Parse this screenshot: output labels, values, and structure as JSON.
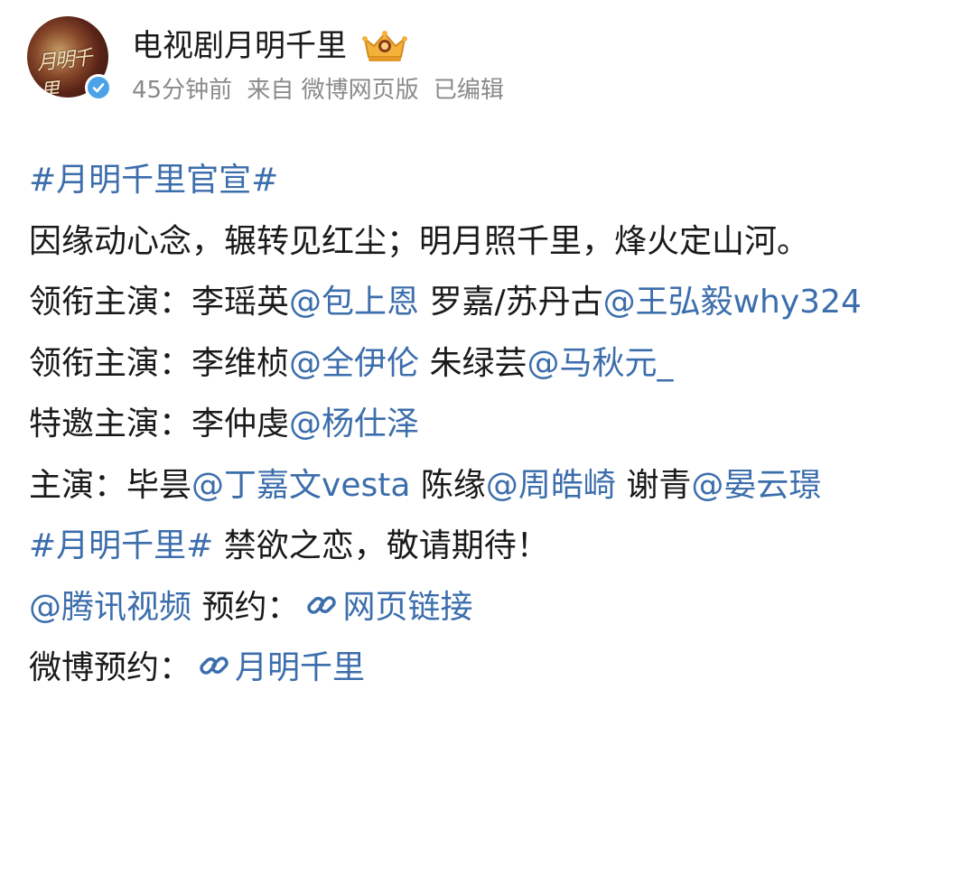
{
  "post": {
    "user_name": "电视剧月明千里",
    "avatar_text": "月明千里",
    "time": "45分钟前",
    "source": "来自 微博网页版",
    "edited": "已编辑"
  },
  "content": {
    "line1_topic": "#月明千里官宣#",
    "line2": "因缘动心念，辗转见红尘；明月照千里，烽火定山河。",
    "line3_label": "领衔主演：李瑶英",
    "line3_mention1": "@包上恩",
    "line3_text2": " 罗嘉/苏丹古",
    "line3_mention2": "@王弘毅why324",
    "line4_label": "领衔主演：李维桢",
    "line4_mention1": "@全伊伦",
    "line4_text2": " 朱绿芸",
    "line4_mention2": "@马秋元_",
    "line5_label": "特邀主演：李仲虔",
    "line5_mention1": "@杨仕泽",
    "line6_label": "主演：毕昙",
    "line6_mention1": "@丁嘉文vesta",
    "line6_text2": " 陈缘",
    "line6_mention2": "@周皓崎",
    "line6_text3": " 谢青",
    "line6_mention3": "@晏云璟",
    "line7_topic": "#月明千里#",
    "line7_text": " 禁欲之恋，敬请期待！",
    "line8_mention": "@腾讯视频",
    "line8_text": " 预约：",
    "line8_link": "网页链接",
    "line9_text": "微博预约：",
    "line9_link": "月明千里"
  },
  "colors": {
    "link": "#3c6eac",
    "text": "#1a1a1a",
    "meta": "#8a8a8a",
    "verify": "#4aa3e8"
  },
  "icons": [
    "crown-icon",
    "verified-icon",
    "link-icon"
  ]
}
